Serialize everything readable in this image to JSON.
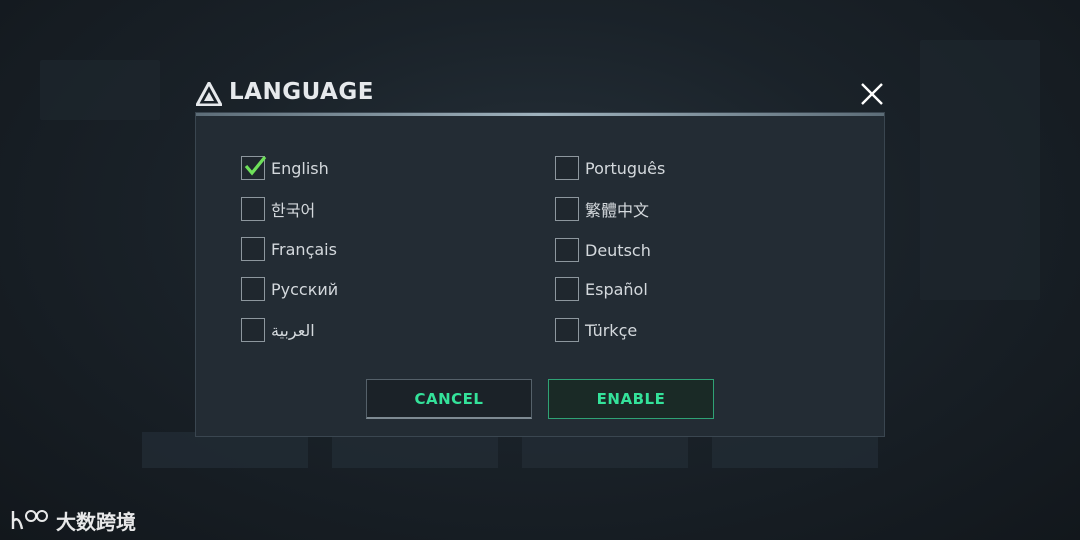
{
  "dialog": {
    "title": "LANGUAGE",
    "close_icon": "close-icon",
    "logo_icon": "triangle-logo-icon"
  },
  "languages": [
    {
      "label": "English",
      "checked": true
    },
    {
      "label": "Português",
      "checked": false
    },
    {
      "label": "한국어",
      "checked": false
    },
    {
      "label": "繁體中文",
      "checked": false
    },
    {
      "label": "Français",
      "checked": false
    },
    {
      "label": "Deutsch",
      "checked": false
    },
    {
      "label": "Русский",
      "checked": false
    },
    {
      "label": "Español",
      "checked": false
    },
    {
      "label": "العربية",
      "checked": false
    },
    {
      "label": "Türkçe",
      "checked": false
    }
  ],
  "buttons": {
    "cancel": "CANCEL",
    "enable": "ENABLE"
  },
  "watermark": {
    "text": "大数跨境"
  },
  "colors": {
    "accent": "#34e29a",
    "check": "#6ee05a",
    "dialog_bg": "#232c34"
  }
}
